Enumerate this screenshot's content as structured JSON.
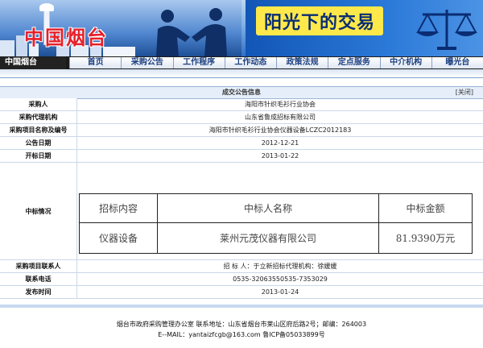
{
  "banner": {
    "brand": "中国烟台",
    "slogan": "阳光下的交易"
  },
  "nav": {
    "home": "中国烟台",
    "items": [
      "首页",
      "采购公告",
      "工作程序",
      "工作动态",
      "政策法规",
      "定点服务",
      "中介机构",
      "曝光台"
    ]
  },
  "notice": {
    "title": "成交公告信息",
    "close": "[关闭]",
    "fields": [
      {
        "label": "采购人",
        "value": "海阳市针织毛衫行业协会"
      },
      {
        "label": "采购代理机构",
        "value": "山东省鲁成招标有限公司"
      },
      {
        "label": "采购项目名称及编号",
        "value": "海阳市针织毛衫行业协会仪器设备LCZC2012183"
      },
      {
        "label": "公告日期",
        "value": "2012-12-21"
      },
      {
        "label": "开标日期",
        "value": "2013-01-22"
      }
    ],
    "award_label": "中标情况",
    "award_headers": [
      "招标内容",
      "中标人名称",
      "中标金额"
    ],
    "award_row": [
      "仪器设备",
      "莱州元茂仪器有限公司",
      "81.9390万元"
    ],
    "contact_label": "采购项目联系人",
    "contact_value": "招 标 人：于立新招标代理机构：徐媛媛",
    "phone_label": "联系电话",
    "phone_value": "0535-32063550535-7353029",
    "publish_label": "发布时间",
    "publish_value": "2013-01-24"
  },
  "footer": {
    "line1": "烟台市政府采购管理办公室 联系地址：山东省烟台市莱山区府后路2号；邮编：264003",
    "line2": "E--MAIL：yantaizfcgb@163.com 鲁ICP备05033899号"
  },
  "colors": {
    "accent": "#1256b6",
    "slogan_bg": "#ffe94a",
    "brand": "#e6202a"
  }
}
